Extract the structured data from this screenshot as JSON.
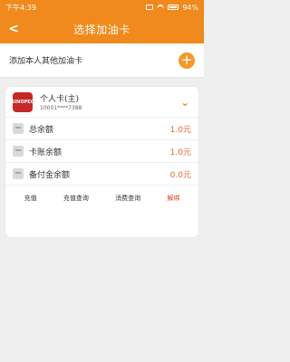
{
  "status": {
    "time": "下午4:39",
    "battery": "94%"
  },
  "header": {
    "back": "<",
    "title": "选择加油卡"
  },
  "add_row": {
    "label": "添加本人其他加油卡",
    "plus": "+"
  },
  "card": {
    "logo_text": "SINOPEC",
    "name": "个人卡(主)",
    "number": "10001****7388",
    "chevron": "⌄",
    "rows": [
      {
        "label": "总余额",
        "value": "1.0元",
        "icon": "wallet-icon"
      },
      {
        "label": "卡账余额",
        "value": "1.0元",
        "icon": "card-icon"
      },
      {
        "label": "备付金余额",
        "value": "0.0元",
        "icon": "reserve-icon"
      }
    ],
    "actions": [
      "充值",
      "充值查询",
      "消费查询",
      "解绑"
    ]
  }
}
